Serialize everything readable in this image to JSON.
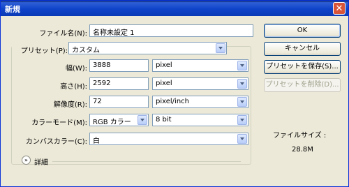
{
  "dialog": {
    "title": "新規",
    "close_glyph": "✕"
  },
  "name": {
    "label": "ファイル名(N):",
    "value": "名称未設定 1"
  },
  "preset": {
    "label": "プリセット(P):",
    "value": "カスタム"
  },
  "width": {
    "label": "幅(W):",
    "value": "3888",
    "unit": "pixel"
  },
  "height": {
    "label": "高さ(H):",
    "value": "2592",
    "unit": "pixel"
  },
  "resolution": {
    "label": "解像度(R):",
    "value": "72",
    "unit": "pixel/inch"
  },
  "color_mode": {
    "label": "カラーモード(M):",
    "value": "RGB カラー",
    "depth": "8 bit"
  },
  "canvas_color": {
    "label": "カンバスカラー(C):",
    "value": "白"
  },
  "advanced": {
    "label": "詳細",
    "glyph": "»"
  },
  "buttons": {
    "ok": "OK",
    "cancel": "キャンセル",
    "save_preset": "プリセットを保存(S)...",
    "delete_preset": "プリセットを削除(D)..."
  },
  "file_size": {
    "label": "ファイルサイズ :",
    "value": "28.8M"
  }
}
